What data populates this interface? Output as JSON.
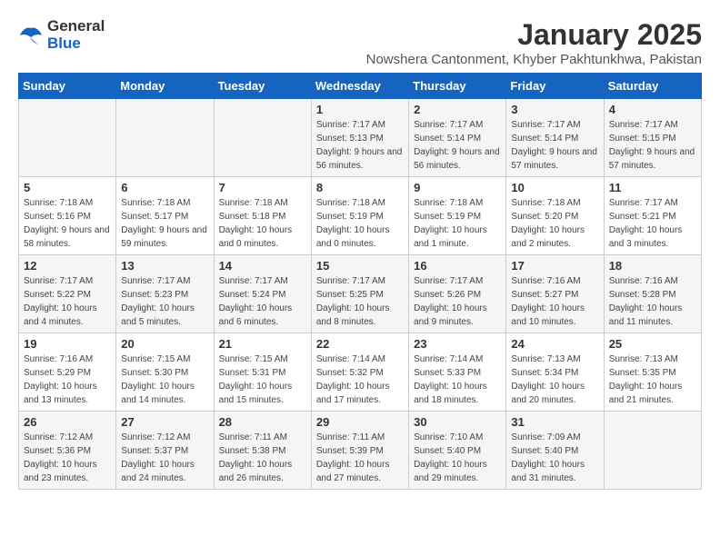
{
  "logo": {
    "text_general": "General",
    "text_blue": "Blue"
  },
  "title": "January 2025",
  "subtitle": "Nowshera Cantonment, Khyber Pakhtunkhwa, Pakistan",
  "headers": [
    "Sunday",
    "Monday",
    "Tuesday",
    "Wednesday",
    "Thursday",
    "Friday",
    "Saturday"
  ],
  "weeks": [
    [
      {
        "day": "",
        "sunrise": "",
        "sunset": "",
        "daylight": ""
      },
      {
        "day": "",
        "sunrise": "",
        "sunset": "",
        "daylight": ""
      },
      {
        "day": "",
        "sunrise": "",
        "sunset": "",
        "daylight": ""
      },
      {
        "day": "1",
        "sunrise": "Sunrise: 7:17 AM",
        "sunset": "Sunset: 5:13 PM",
        "daylight": "Daylight: 9 hours and 56 minutes."
      },
      {
        "day": "2",
        "sunrise": "Sunrise: 7:17 AM",
        "sunset": "Sunset: 5:14 PM",
        "daylight": "Daylight: 9 hours and 56 minutes."
      },
      {
        "day": "3",
        "sunrise": "Sunrise: 7:17 AM",
        "sunset": "Sunset: 5:14 PM",
        "daylight": "Daylight: 9 hours and 57 minutes."
      },
      {
        "day": "4",
        "sunrise": "Sunrise: 7:17 AM",
        "sunset": "Sunset: 5:15 PM",
        "daylight": "Daylight: 9 hours and 57 minutes."
      }
    ],
    [
      {
        "day": "5",
        "sunrise": "Sunrise: 7:18 AM",
        "sunset": "Sunset: 5:16 PM",
        "daylight": "Daylight: 9 hours and 58 minutes."
      },
      {
        "day": "6",
        "sunrise": "Sunrise: 7:18 AM",
        "sunset": "Sunset: 5:17 PM",
        "daylight": "Daylight: 9 hours and 59 minutes."
      },
      {
        "day": "7",
        "sunrise": "Sunrise: 7:18 AM",
        "sunset": "Sunset: 5:18 PM",
        "daylight": "Daylight: 10 hours and 0 minutes."
      },
      {
        "day": "8",
        "sunrise": "Sunrise: 7:18 AM",
        "sunset": "Sunset: 5:19 PM",
        "daylight": "Daylight: 10 hours and 0 minutes."
      },
      {
        "day": "9",
        "sunrise": "Sunrise: 7:18 AM",
        "sunset": "Sunset: 5:19 PM",
        "daylight": "Daylight: 10 hours and 1 minute."
      },
      {
        "day": "10",
        "sunrise": "Sunrise: 7:18 AM",
        "sunset": "Sunset: 5:20 PM",
        "daylight": "Daylight: 10 hours and 2 minutes."
      },
      {
        "day": "11",
        "sunrise": "Sunrise: 7:17 AM",
        "sunset": "Sunset: 5:21 PM",
        "daylight": "Daylight: 10 hours and 3 minutes."
      }
    ],
    [
      {
        "day": "12",
        "sunrise": "Sunrise: 7:17 AM",
        "sunset": "Sunset: 5:22 PM",
        "daylight": "Daylight: 10 hours and 4 minutes."
      },
      {
        "day": "13",
        "sunrise": "Sunrise: 7:17 AM",
        "sunset": "Sunset: 5:23 PM",
        "daylight": "Daylight: 10 hours and 5 minutes."
      },
      {
        "day": "14",
        "sunrise": "Sunrise: 7:17 AM",
        "sunset": "Sunset: 5:24 PM",
        "daylight": "Daylight: 10 hours and 6 minutes."
      },
      {
        "day": "15",
        "sunrise": "Sunrise: 7:17 AM",
        "sunset": "Sunset: 5:25 PM",
        "daylight": "Daylight: 10 hours and 8 minutes."
      },
      {
        "day": "16",
        "sunrise": "Sunrise: 7:17 AM",
        "sunset": "Sunset: 5:26 PM",
        "daylight": "Daylight: 10 hours and 9 minutes."
      },
      {
        "day": "17",
        "sunrise": "Sunrise: 7:16 AM",
        "sunset": "Sunset: 5:27 PM",
        "daylight": "Daylight: 10 hours and 10 minutes."
      },
      {
        "day": "18",
        "sunrise": "Sunrise: 7:16 AM",
        "sunset": "Sunset: 5:28 PM",
        "daylight": "Daylight: 10 hours and 11 minutes."
      }
    ],
    [
      {
        "day": "19",
        "sunrise": "Sunrise: 7:16 AM",
        "sunset": "Sunset: 5:29 PM",
        "daylight": "Daylight: 10 hours and 13 minutes."
      },
      {
        "day": "20",
        "sunrise": "Sunrise: 7:15 AM",
        "sunset": "Sunset: 5:30 PM",
        "daylight": "Daylight: 10 hours and 14 minutes."
      },
      {
        "day": "21",
        "sunrise": "Sunrise: 7:15 AM",
        "sunset": "Sunset: 5:31 PM",
        "daylight": "Daylight: 10 hours and 15 minutes."
      },
      {
        "day": "22",
        "sunrise": "Sunrise: 7:14 AM",
        "sunset": "Sunset: 5:32 PM",
        "daylight": "Daylight: 10 hours and 17 minutes."
      },
      {
        "day": "23",
        "sunrise": "Sunrise: 7:14 AM",
        "sunset": "Sunset: 5:33 PM",
        "daylight": "Daylight: 10 hours and 18 minutes."
      },
      {
        "day": "24",
        "sunrise": "Sunrise: 7:13 AM",
        "sunset": "Sunset: 5:34 PM",
        "daylight": "Daylight: 10 hours and 20 minutes."
      },
      {
        "day": "25",
        "sunrise": "Sunrise: 7:13 AM",
        "sunset": "Sunset: 5:35 PM",
        "daylight": "Daylight: 10 hours and 21 minutes."
      }
    ],
    [
      {
        "day": "26",
        "sunrise": "Sunrise: 7:12 AM",
        "sunset": "Sunset: 5:36 PM",
        "daylight": "Daylight: 10 hours and 23 minutes."
      },
      {
        "day": "27",
        "sunrise": "Sunrise: 7:12 AM",
        "sunset": "Sunset: 5:37 PM",
        "daylight": "Daylight: 10 hours and 24 minutes."
      },
      {
        "day": "28",
        "sunrise": "Sunrise: 7:11 AM",
        "sunset": "Sunset: 5:38 PM",
        "daylight": "Daylight: 10 hours and 26 minutes."
      },
      {
        "day": "29",
        "sunrise": "Sunrise: 7:11 AM",
        "sunset": "Sunset: 5:39 PM",
        "daylight": "Daylight: 10 hours and 27 minutes."
      },
      {
        "day": "30",
        "sunrise": "Sunrise: 7:10 AM",
        "sunset": "Sunset: 5:40 PM",
        "daylight": "Daylight: 10 hours and 29 minutes."
      },
      {
        "day": "31",
        "sunrise": "Sunrise: 7:09 AM",
        "sunset": "Sunset: 5:40 PM",
        "daylight": "Daylight: 10 hours and 31 minutes."
      },
      {
        "day": "",
        "sunrise": "",
        "sunset": "",
        "daylight": ""
      }
    ]
  ]
}
